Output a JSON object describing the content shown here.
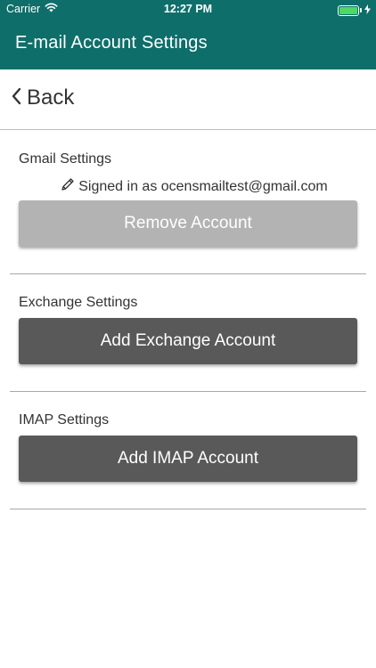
{
  "status_bar": {
    "carrier": "Carrier",
    "time": "12:27 PM",
    "battery_color": "#4cd964",
    "icons": [
      "wifi-icon",
      "battery-icon",
      "charging-icon"
    ]
  },
  "header": {
    "title": "E-mail Account Settings",
    "background": "#0e6e6a"
  },
  "nav": {
    "back_label": "Back",
    "back_icon": "chevron-left-icon"
  },
  "gmail": {
    "section_label": "Gmail Settings",
    "signed_in_text": "Signed in as ocensmailtest@gmail.com",
    "signed_in_icon": "pencil-icon",
    "button_label": "Remove Account",
    "button_color": "#b3b3b3"
  },
  "exchange": {
    "section_label": "Exchange Settings",
    "button_label": "Add Exchange Account",
    "button_color": "#595959"
  },
  "imap": {
    "section_label": "IMAP Settings",
    "button_label": "Add IMAP Account",
    "button_color": "#595959"
  }
}
